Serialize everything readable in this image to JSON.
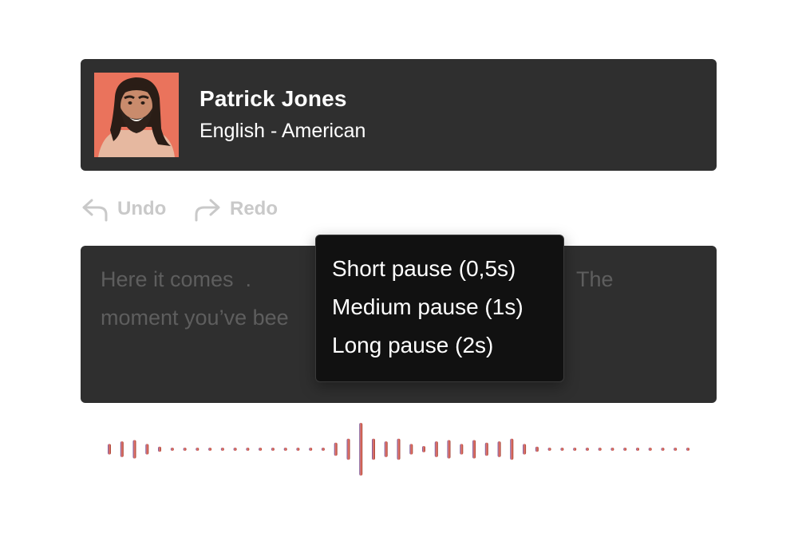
{
  "voice": {
    "name": "Patrick Jones",
    "language": "English - American"
  },
  "history": {
    "undo_label": "Undo",
    "redo_label": "Redo"
  },
  "editor": {
    "line1": "Here it comes  .",
    "line1_tail": "The",
    "line2": "moment you’ve bee"
  },
  "pause_menu": {
    "items": [
      "Short pause (0,5s)",
      "Medium pause (1s)",
      "Long pause (2s)"
    ]
  },
  "waveform": {
    "gradient_start": "#6b5aa6",
    "gradient_mid": "#f07a6a",
    "gradient_end": "#9a3c30",
    "levels": [
      0.2,
      0.3,
      0.35,
      0.2,
      0.1,
      0.05,
      0.05,
      0.05,
      0.05,
      0.05,
      0.05,
      0.05,
      0.05,
      0.05,
      0.05,
      0.05,
      0.05,
      0.05,
      0.25,
      0.4,
      1.0,
      0.4,
      0.3,
      0.4,
      0.2,
      0.12,
      0.3,
      0.35,
      0.2,
      0.35,
      0.25,
      0.3,
      0.4,
      0.2,
      0.1,
      0.05,
      0.05,
      0.05,
      0.05,
      0.05,
      0.05,
      0.05,
      0.05,
      0.05,
      0.05,
      0.05,
      0.05
    ]
  }
}
